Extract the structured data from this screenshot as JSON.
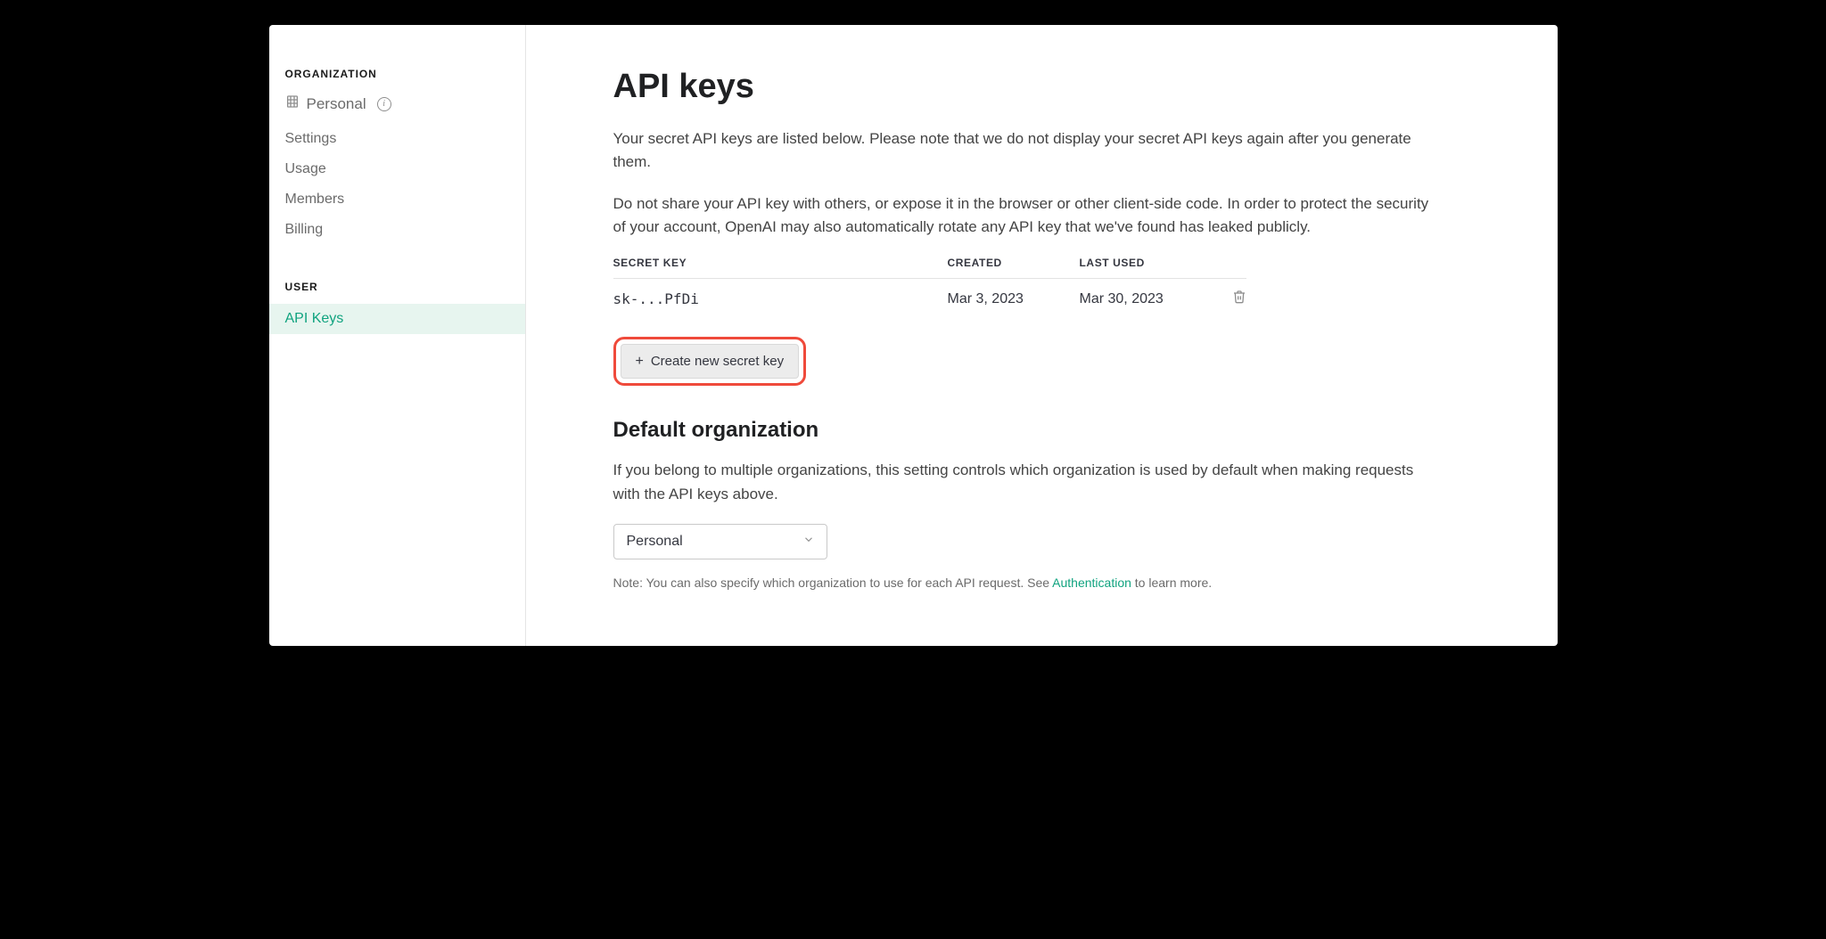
{
  "sidebar": {
    "organization": {
      "header": "ORGANIZATION",
      "personal_label": "Personal",
      "items": [
        {
          "label": "Settings"
        },
        {
          "label": "Usage"
        },
        {
          "label": "Members"
        },
        {
          "label": "Billing"
        }
      ]
    },
    "user": {
      "header": "USER",
      "items": [
        {
          "label": "API Keys"
        }
      ]
    }
  },
  "main": {
    "title": "API keys",
    "desc1": "Your secret API keys are listed below. Please note that we do not display your secret API keys again after you generate them.",
    "desc2": "Do not share your API key with others, or expose it in the browser or other client-side code. In order to protect the security of your account, OpenAI may also automatically rotate any API key that we've found has leaked publicly.",
    "table": {
      "headers": {
        "key": "SECRET KEY",
        "created": "CREATED",
        "used": "LAST USED"
      },
      "rows": [
        {
          "key": "sk-...PfDi",
          "created": "Mar 3, 2023",
          "used": "Mar 30, 2023"
        }
      ]
    },
    "create_button": "Create new secret key",
    "default_org": {
      "title": "Default organization",
      "desc": "If you belong to multiple organizations, this setting controls which organization is used by default when making requests with the API keys above.",
      "selected": "Personal",
      "note_prefix": "Note: You can also specify which organization to use for each API request. See ",
      "note_link": "Authentication",
      "note_suffix": " to learn more."
    }
  }
}
